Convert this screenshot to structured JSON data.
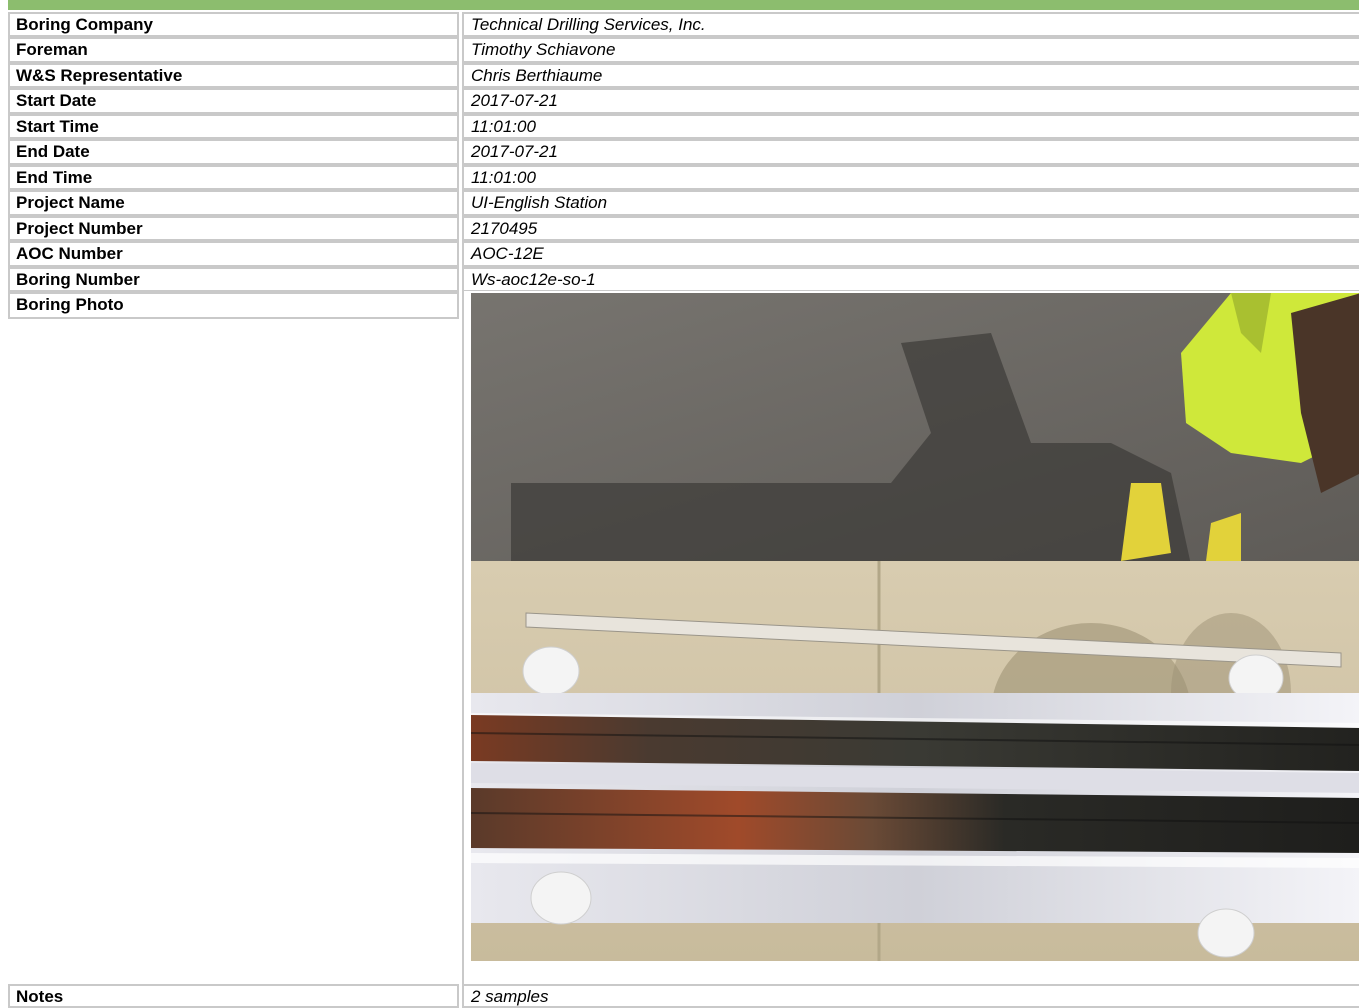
{
  "rows": [
    {
      "label": "Boring Company",
      "value": "Technical Drilling Services, Inc."
    },
    {
      "label": "Foreman",
      "value": "Timothy Schiavone"
    },
    {
      "label": "W&S Representative",
      "value": "Chris Berthiaume"
    },
    {
      "label": "Start Date",
      "value": "2017-07-21"
    },
    {
      "label": "Start Time",
      "value": "11:01:00"
    },
    {
      "label": "End Date",
      "value": "2017-07-21"
    },
    {
      "label": "End Time",
      "value": "11:01:00"
    },
    {
      "label": "Project Name",
      "value": "UI-English Station"
    },
    {
      "label": "Project Number",
      "value": "2170495"
    },
    {
      "label": "AOC Number",
      "value": "AOC-12E"
    },
    {
      "label": "Boring Number",
      "value": "Ws-aoc12e-so-1"
    }
  ],
  "photo_label": "Boring Photo",
  "notes": {
    "label": "Notes",
    "value": "2 samples"
  },
  "colors": {
    "header_bar": "#8cbd6e",
    "border": "#c9c9c9"
  }
}
